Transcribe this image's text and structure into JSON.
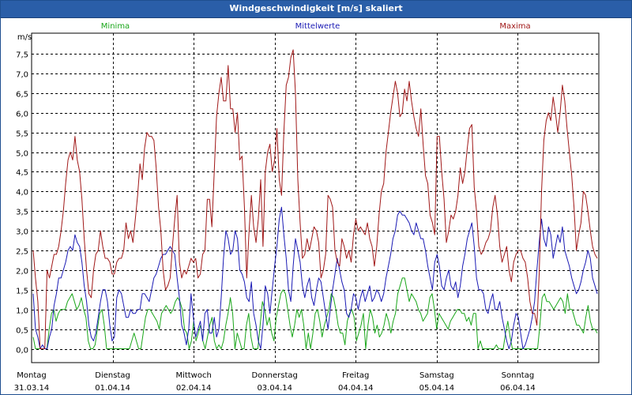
{
  "window": {
    "title": "Windgeschwindigkeit [m/s] skaliert"
  },
  "colors": {
    "minima": "#1aa61a",
    "mittelwerte": "#1a1ab4",
    "maxima": "#a01818",
    "titlebar": "#2a5ea8",
    "grid": "#000000"
  },
  "chart_data": {
    "type": "line",
    "title": "Windgeschwindigkeit [m/s] skaliert",
    "ylabel": "m/s",
    "ylim": [
      0,
      8
    ],
    "yticks": [
      "0,0",
      "0,5",
      "1,0",
      "1,5",
      "2,0",
      "2,5",
      "3,0",
      "3,5",
      "4,0",
      "4,5",
      "5,0",
      "5,5",
      "6,0",
      "6,5",
      "7,0",
      "7,5"
    ],
    "x_categories": [
      {
        "day": "Montag",
        "date": "31.03.14"
      },
      {
        "day": "Dienstag",
        "date": "01.04.14"
      },
      {
        "day": "Mittwoch",
        "date": "02.04.14"
      },
      {
        "day": "Donnerstag",
        "date": "03.04.14"
      },
      {
        "day": "Freitag",
        "date": "04.04.14"
      },
      {
        "day": "Samstag",
        "date": "05.04.14"
      },
      {
        "day": "Sonntag",
        "date": "06.04.14"
      }
    ],
    "grid": true,
    "series": [
      {
        "name": "Minima",
        "color": "#1aa61a",
        "values": [
          0.3,
          0,
          0,
          0,
          0,
          0,
          0,
          0.5,
          0.9,
          1,
          0.7,
          0.9,
          1,
          1,
          1,
          1.2,
          1.3,
          1.4,
          1.2,
          1,
          1.1,
          1.3,
          1,
          0.8,
          0.2,
          0,
          0,
          0.1,
          0.5,
          0.9,
          1,
          0.6,
          0,
          0,
          0,
          0,
          0,
          0,
          0,
          0,
          0,
          0,
          0,
          0.2,
          0.4,
          0.2,
          0,
          0,
          0.4,
          0.8,
          1,
          1,
          0.9,
          0.8,
          0.7,
          0.5,
          0.9,
          1,
          1.1,
          1,
          0.9,
          1,
          1.2,
          1.3,
          1.2,
          1,
          0.5,
          0.4,
          0,
          0.2,
          0.7,
          0.2,
          0.4,
          0.6,
          0.2,
          0,
          0.3,
          0.6,
          0.8,
          0.2,
          0,
          0.1,
          0,
          0.2,
          0.6,
          0.9,
          1.3,
          0.9,
          0,
          0.4,
          0.2,
          0,
          0,
          0.6,
          0.9,
          0.3,
          0,
          0,
          0,
          0.6,
          1.2,
          1,
          0.6,
          0.8,
          0.4,
          0.2,
          0.8,
          1.1,
          1.4,
          1.5,
          1.4,
          1,
          0.6,
          0.3,
          0.6,
          1,
          0.8,
          1,
          0.6,
          0,
          0.4,
          0,
          0.4,
          0.9,
          1,
          0.7,
          0.3,
          0.6,
          0.8,
          1,
          1.4,
          1.3,
          1,
          0.6,
          0.4,
          0.4,
          0.1,
          0.7,
          0.9,
          1,
          0.8,
          0.2,
          0.4,
          0.6,
          0.9,
          0,
          0.6,
          1,
          0.8,
          0.4,
          0.6,
          0.3,
          0.4,
          0.6,
          0.9,
          0.7,
          0.4,
          0.7,
          0.9,
          1.4,
          1.6,
          1.8,
          1.8,
          1.5,
          1.2,
          1.4,
          1.3,
          1.2,
          1,
          0.9,
          0.7,
          0.8,
          0.9,
          1.3,
          1.4,
          1,
          0.5,
          0.9,
          0.8,
          0.7,
          0.6,
          0.5,
          0.7,
          0.8,
          0.9,
          1,
          1,
          0.9,
          0.9,
          0.7,
          0.8,
          0.6,
          0.9,
          0.9,
          0,
          0.2,
          0,
          0,
          0,
          0,
          0,
          0,
          0.1,
          0,
          0,
          0,
          0.4,
          0.7,
          0.3,
          0,
          0,
          0,
          0,
          0,
          0,
          0,
          0,
          0,
          0,
          0,
          0,
          0.6,
          1.3,
          1.4,
          1.2,
          1.2,
          1.1,
          1,
          1.1,
          1.2,
          1.3,
          1.2,
          0.9,
          1.4,
          1,
          1,
          0.8,
          0.6,
          0.6,
          0.5,
          0.4,
          0.8,
          1.1,
          0.7,
          0.5,
          0.5,
          0.4
        ],
        "name_color": "#1aa61a"
      },
      {
        "name": "Mittelwerte",
        "color": "#1a1ab4",
        "values": [
          1.4,
          0.5,
          0.3,
          0,
          0.1,
          0,
          0,
          0.3,
          0.5,
          1.1,
          1.4,
          1.8,
          1.8,
          2,
          2.2,
          2.5,
          2.6,
          2.5,
          2.9,
          2.7,
          2.6,
          2.2,
          1.6,
          1.2,
          0.6,
          0.3,
          0.2,
          0.4,
          0.8,
          1.2,
          1.5,
          1.5,
          1.2,
          0.6,
          0.2,
          0.3,
          1.3,
          1.5,
          1.4,
          1.1,
          0.8,
          0.8,
          1,
          0.9,
          0.9,
          1,
          1,
          1.4,
          1.4,
          1.3,
          1.2,
          1.5,
          1.8,
          1.9,
          2.1,
          2.3,
          2.4,
          2.4,
          2.5,
          2.6,
          2.5,
          2.4,
          1.8,
          1.3,
          0.6,
          0.4,
          0.1,
          0.5,
          1.4,
          0.8,
          0.3,
          0.5,
          0.7,
          0.2,
          0.9,
          1,
          0.4,
          0.4,
          0.8,
          0.3,
          0.5,
          1.3,
          2.3,
          3,
          2.8,
          2.4,
          2.5,
          3,
          2.8,
          2,
          1.9,
          1.7,
          1.3,
          1.2,
          1.7,
          0.9,
          0.6,
          0.2,
          0,
          0.6,
          1.6,
          1.4,
          0.9,
          1.5,
          2.1,
          2.6,
          3.3,
          3.6,
          2.9,
          2.3,
          1.5,
          1.2,
          2.1,
          2.8,
          2.5,
          2.2,
          1.6,
          1.3,
          1.6,
          1.8,
          1.3,
          1.1,
          1.5,
          1.8,
          1.7,
          1.3,
          0.9,
          0.5,
          1,
          1.5,
          1.9,
          2.3,
          2,
          1.7,
          1.5,
          0.9,
          0.8,
          1,
          1.4,
          1.3,
          1,
          1.3,
          1.5,
          1.2,
          1.4,
          1.6,
          1.2,
          1.3,
          1.5,
          1.4,
          1.2,
          1.4,
          1.8,
          2.1,
          2.4,
          2.8,
          3,
          3.4,
          3.5,
          3.4,
          3.4,
          3.3,
          3.2,
          3,
          2.9,
          3.2,
          3,
          2.8,
          2.8,
          2.5,
          2.1,
          1.8,
          1.5,
          2.2,
          2.4,
          2.1,
          1.6,
          1.5,
          1.8,
          2,
          1.6,
          1.5,
          1.7,
          1.3,
          1.6,
          2.1,
          2.4,
          2.8,
          3,
          3.2,
          2.6,
          1.8,
          1.5,
          1.5,
          1.4,
          1,
          0.9,
          1.2,
          1.4,
          1,
          1,
          1.2,
          0.8,
          0.5,
          0.2,
          0,
          0.2,
          0.6,
          0.9,
          0.8,
          0.4,
          0,
          0.1,
          0.3,
          0.5,
          0.8,
          1.2,
          2,
          2.7,
          3.3,
          2.8,
          2.6,
          3.1,
          2.9,
          2.3,
          2.6,
          2.9,
          2.7,
          3.1,
          2.5,
          2.3,
          2.1,
          1.8,
          1.6,
          1.4,
          1.5,
          1.7,
          2,
          2.2,
          2.5,
          2.3,
          1.8,
          1.6,
          1.4
        ]
      },
      {
        "name": "Maxima",
        "color": "#a01818",
        "values": [
          2.5,
          1.8,
          1.2,
          0,
          0,
          0,
          2,
          1.8,
          2.1,
          2.4,
          2.4,
          2.6,
          3,
          3.5,
          4.2,
          4.8,
          5,
          4.8,
          5.4,
          4.8,
          4.5,
          3.8,
          2.8,
          2,
          1.4,
          1.3,
          2,
          2.4,
          2.5,
          3,
          2.6,
          2.3,
          2.3,
          2.2,
          1.9,
          1.9,
          2.2,
          2.3,
          2.3,
          2.5,
          3.2,
          2.8,
          3,
          2.7,
          3.3,
          3.9,
          4.7,
          4.3,
          5.1,
          5.5,
          5.4,
          5.4,
          5.3,
          4.6,
          3.6,
          3,
          2,
          1.5,
          1.6,
          1.8,
          2.6,
          3.3,
          3.9,
          2.2,
          1.8,
          2,
          1.9,
          2.1,
          2.3,
          2.2,
          2.3,
          1.8,
          1.9,
          2.4,
          2.5,
          3.8,
          3.8,
          3.1,
          4.5,
          5.9,
          6.5,
          6.9,
          6.3,
          6.3,
          7.2,
          6.1,
          6.1,
          5.5,
          6,
          4.8,
          4.9,
          3.6,
          1.8,
          3,
          3.9,
          3.1,
          2.7,
          3.3,
          4.3,
          2.6,
          4.5,
          5,
          5.2,
          4.5,
          4.8,
          5.6,
          4.3,
          3.9,
          5.5,
          6.7,
          6.9,
          7.4,
          7.6,
          6.5,
          4.3,
          3.2,
          2.3,
          2.4,
          2.8,
          2.5,
          2.8,
          3.1,
          3,
          2.7,
          1.8,
          2,
          2.4,
          3.9,
          3.8,
          3.6,
          2.5,
          2.2,
          2.1,
          2.8,
          2.6,
          2.3,
          2.5,
          2.2,
          2.9,
          3.3,
          3,
          3.1,
          3,
          2.9,
          3.2,
          2.8,
          2.6,
          2.1,
          2.6,
          3.4,
          4,
          4.2,
          5,
          5.5,
          6,
          6.4,
          6.8,
          6.5,
          5.9,
          6,
          6.6,
          6.3,
          6.8,
          6.3,
          5.9,
          5.6,
          5.4,
          6.1,
          5.2,
          4.4,
          4.2,
          3.4,
          3.2,
          2.9,
          5.4,
          5.4,
          4.5,
          3.8,
          2.7,
          3,
          3.4,
          3.3,
          3.5,
          3.9,
          4.6,
          4.2,
          4.5,
          5.1,
          5.6,
          5.7,
          4.1,
          3.5,
          2.6,
          2.4,
          2.5,
          2.7,
          2.8,
          3,
          3.6,
          3.9,
          3.4,
          2.6,
          2.2,
          2.4,
          2.6,
          2,
          1.7,
          2.2,
          2.4,
          2.5,
          2.5,
          2.3,
          2.2,
          1.8,
          1.2,
          0.9,
          0.9,
          0.6,
          1.9,
          4,
          5.3,
          5.8,
          6,
          5.8,
          6.4,
          6,
          5.5,
          6,
          6.7,
          6.3,
          5.6,
          5,
          4.4,
          3.6,
          2.5,
          2.9,
          3.2,
          4,
          3.9,
          3.5,
          3,
          2.6,
          2.4,
          2.3
        ]
      }
    ]
  }
}
